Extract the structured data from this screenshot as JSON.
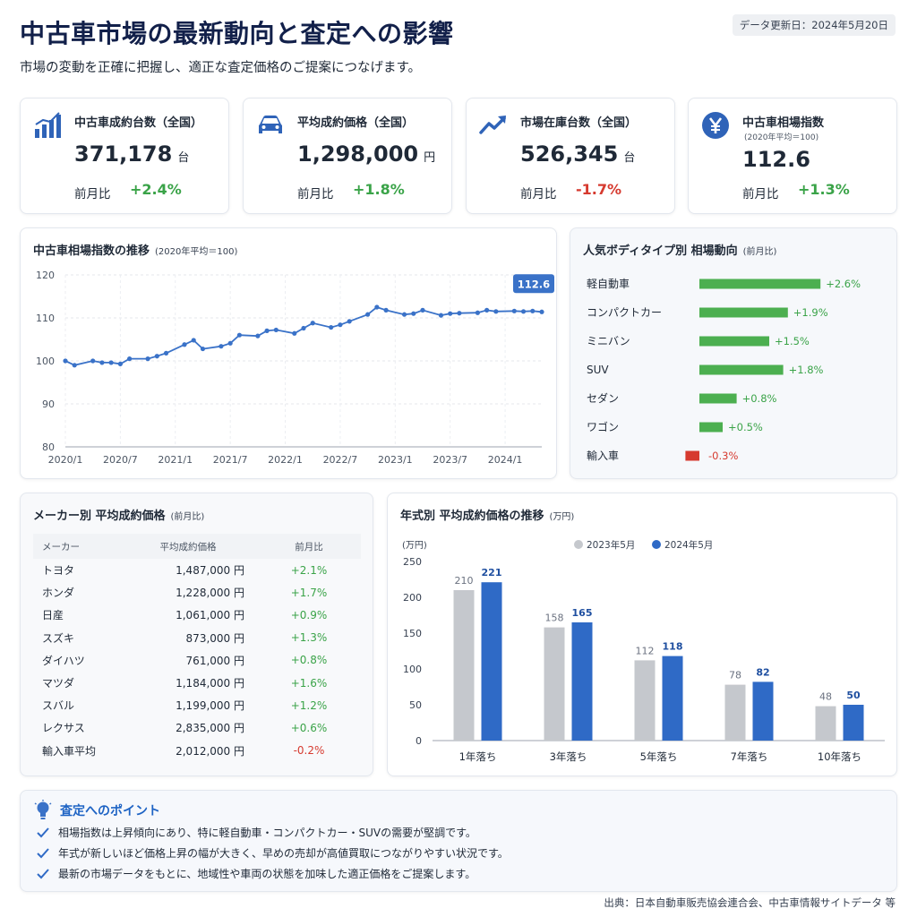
{
  "header": {
    "title": "中古車市場の最新動向と査定への影響",
    "subtitle": "市場の変動を正確に把握し、適正な査定価格のご提案につなげます。",
    "updated": "データ更新日：2024年5月20日"
  },
  "kpis": [
    {
      "icon": "bar-chart-icon",
      "label": "中古車成約台数（全国）",
      "sub": "",
      "value": "371,178",
      "unit": "台",
      "compare_label": "前月比",
      "change": "+2.4%",
      "trend": "up"
    },
    {
      "icon": "car-icon",
      "label": "平均成約価格（全国）",
      "sub": "",
      "value": "1,298,000",
      "unit": "円",
      "compare_label": "前月比",
      "change": "+1.8%",
      "trend": "up"
    },
    {
      "icon": "trend-up-icon",
      "label": "市場在庫台数（全国）",
      "sub": "",
      "value": "526,345",
      "unit": "台",
      "compare_label": "前月比",
      "change": "-1.7%",
      "trend": "down"
    },
    {
      "icon": "yen-icon",
      "label": "中古車相場指数",
      "sub": "(2020年平均＝100)",
      "value": "112.6",
      "unit": "",
      "compare_label": "前月比",
      "change": "+1.3%",
      "trend": "up"
    }
  ],
  "colors": {
    "accent": "#3a72c8",
    "positive": "#3aa348",
    "negative": "#d63a2f",
    "gray_bar": "#c5c8cd",
    "blue_bar": "#2f6ac6"
  },
  "chart_data": [
    {
      "type": "line",
      "title": "中古車相場指数の推移",
      "note": "(2020年平均＝100)",
      "x_ticks": [
        "2020/1",
        "2020/7",
        "2021/1",
        "2021/7",
        "2022/1",
        "2022/7",
        "2023/1",
        "2023/7",
        "2024/1"
      ],
      "x": [
        "2020/1",
        "2020/2",
        "2020/4",
        "2020/5",
        "2020/6",
        "2020/7",
        "2020/8",
        "2020/10",
        "2020/11",
        "2020/12",
        "2021/2",
        "2021/3",
        "2021/4",
        "2021/6",
        "2021/7",
        "2021/8",
        "2021/10",
        "2021/11",
        "2021/12",
        "2022/2",
        "2022/3",
        "2022/4",
        "2022/6",
        "2022/7",
        "2022/8",
        "2022/10",
        "2022/11",
        "2022/12",
        "2023/2",
        "2023/3",
        "2023/4",
        "2023/6",
        "2023/7",
        "2023/8",
        "2023/10",
        "2023/11",
        "2023/12",
        "2024/2",
        "2024/3",
        "2024/4",
        "2024/5"
      ],
      "values": [
        100.0,
        99.0,
        100.0,
        99.6,
        99.6,
        99.3,
        100.5,
        100.5,
        101.1,
        101.8,
        103.8,
        104.8,
        102.8,
        103.4,
        104.1,
        106.0,
        105.8,
        107.0,
        107.2,
        106.4,
        107.6,
        108.8,
        107.8,
        108.4,
        109.2,
        110.8,
        112.5,
        111.8,
        110.8,
        111.0,
        111.8,
        110.6,
        111.0,
        111.1,
        111.2,
        111.8,
        111.5,
        111.6,
        111.5,
        111.6,
        111.4
      ],
      "current_label": "112.6",
      "ylim": [
        80,
        120
      ],
      "y_ticks": [
        80,
        90,
        100,
        110,
        120
      ],
      "grid": true
    },
    {
      "type": "bar",
      "orientation": "horizontal",
      "title": "人気ボディタイプ別 相場動向",
      "note": "(前月比)",
      "categories": [
        "軽自動車",
        "コンパクトカー",
        "ミニバン",
        "SUV",
        "セダン",
        "ワゴン",
        "輸入車"
      ],
      "values": [
        2.6,
        1.9,
        1.5,
        1.8,
        0.8,
        0.5,
        -0.3
      ],
      "labels": [
        "+2.6%",
        "+1.9%",
        "+1.5%",
        "+1.8%",
        "+0.8%",
        "+0.5%",
        "-0.3%"
      ]
    },
    {
      "type": "table",
      "title": "メーカー別 平均成約価格",
      "note": "(前月比)",
      "columns": [
        "メーカー",
        "平均成約価格",
        "前月比"
      ],
      "rows": [
        [
          "トヨタ",
          "1,487,000 円",
          "+2.1%"
        ],
        [
          "ホンダ",
          "1,228,000 円",
          "+1.7%"
        ],
        [
          "日産",
          "1,061,000 円",
          "+0.9%"
        ],
        [
          "スズキ",
          "873,000 円",
          "+1.3%"
        ],
        [
          "ダイハツ",
          "761,000 円",
          "+0.8%"
        ],
        [
          "マツダ",
          "1,184,000 円",
          "+1.6%"
        ],
        [
          "スバル",
          "1,199,000 円",
          "+1.2%"
        ],
        [
          "レクサス",
          "2,835,000 円",
          "+0.6%"
        ],
        [
          "輸入車平均",
          "2,012,000 円",
          "-0.2%"
        ]
      ]
    },
    {
      "type": "bar",
      "title": "年式別 平均成約価格の推移",
      "note": "(万円)",
      "ylabel": "(万円)",
      "categories": [
        "1年落ち",
        "3年落ち",
        "5年落ち",
        "7年落ち",
        "10年落ち"
      ],
      "series": [
        {
          "name": "2023年5月",
          "values": [
            210,
            158,
            112,
            78,
            48
          ]
        },
        {
          "name": "2024年5月",
          "values": [
            221,
            165,
            118,
            82,
            50
          ]
        }
      ],
      "ylim": [
        0,
        250
      ],
      "y_ticks": [
        0,
        50,
        100,
        150,
        200,
        250
      ],
      "legend": "top"
    }
  ],
  "points": {
    "title": "査定へのポイント",
    "items": [
      "相場指数は上昇傾向にあり、特に軽自動車・コンパクトカー・SUVの需要が堅調です。",
      "年式が新しいほど価格上昇の幅が大きく、早めの売却が高値買取につながりやすい状況です。",
      "最新の市場データをもとに、地域性や車両の状態を加味した適正価格をご提案します。"
    ]
  },
  "source": "出典：日本自動車販売協会連合会、中古車情報サイトデータ 等"
}
